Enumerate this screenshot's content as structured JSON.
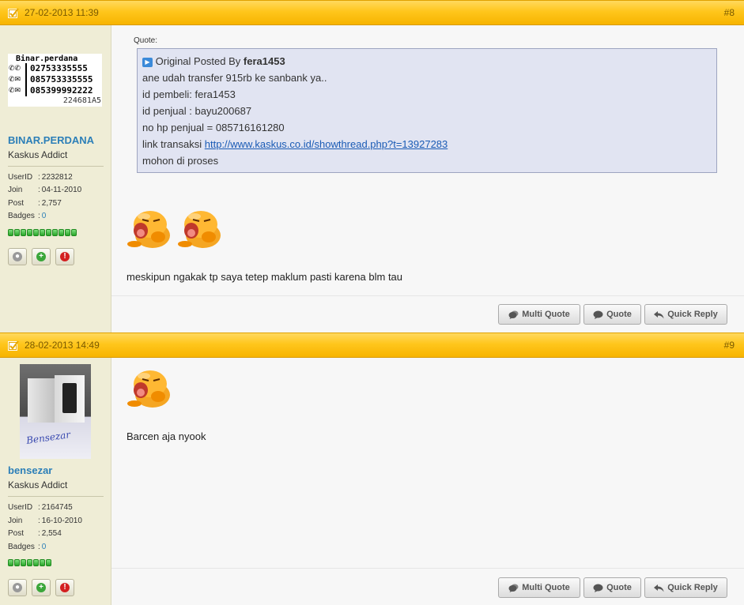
{
  "posts": [
    {
      "date": "27-02-2013 11:39",
      "number": "#8",
      "user": {
        "avatar_lines": [
          "Binar.perdana",
          "02753335555",
          "085753335555",
          "085399992222",
          "224681A5"
        ],
        "name": "BINAR.PERDANA",
        "title": "Kaskus Addict",
        "info": [
          {
            "key": "UserID",
            "value": "2232812"
          },
          {
            "key": "Join",
            "value": "04-11-2010"
          },
          {
            "key": "Post",
            "value": "2,757"
          },
          {
            "key": "Badges",
            "value": "0"
          }
        ],
        "reputation_bars": 11
      },
      "quote": {
        "label": "Quote:",
        "posted_by_prefix": "Original Posted By",
        "posted_by_user": "fera1453",
        "lines": [
          "ane udah transfer 915rb ke sanbank ya..",
          "id pembeli: fera1453",
          "id penjual : bayu200687",
          "no hp penjual = 085716161280"
        ],
        "link_prefix": "link transaksi",
        "link_text": "http://www.kaskus.co.id/showthread.php?t=13927283",
        "last_line": "mohon di proses"
      },
      "emote_count": 2,
      "message": "meskipun ngakak tp saya tetep maklum pasti karena blm tau"
    },
    {
      "date": "28-02-2013 14:49",
      "number": "#9",
      "user": {
        "name": "bensezar",
        "title": "Kaskus Addict",
        "info": [
          {
            "key": "UserID",
            "value": "2164745"
          },
          {
            "key": "Join",
            "value": "16-10-2010"
          },
          {
            "key": "Post",
            "value": "2,554"
          },
          {
            "key": "Badges",
            "value": "0"
          }
        ],
        "reputation_bars": 7
      },
      "emote_count": 1,
      "message": "Barcen aja nyook"
    }
  ],
  "actions": {
    "multi_quote": "Multi Quote",
    "quote": "Quote",
    "quick_reply": "Quick Reply"
  },
  "colors": {
    "header_gold": "#ffc61c",
    "sidebar_bg": "#efedd6",
    "username_blue": "#2c7fb8",
    "quote_bg": "#e1e4f2"
  }
}
